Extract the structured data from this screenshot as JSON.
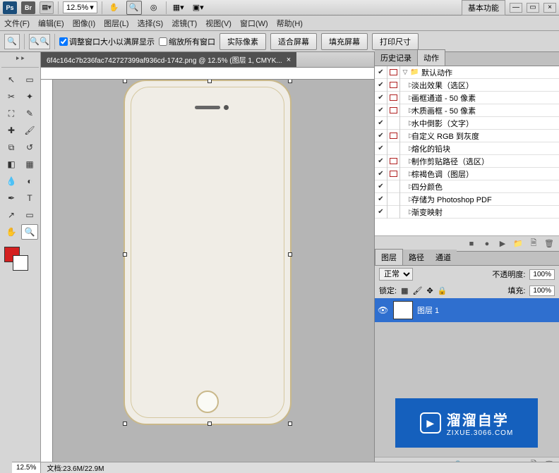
{
  "titlebar": {
    "ps_label": "Ps",
    "br_label": "Br",
    "zoom": "12.5%",
    "workspace": "基本功能"
  },
  "menus": [
    "文件(F)",
    "编辑(E)",
    "图像(I)",
    "图层(L)",
    "选择(S)",
    "滤镜(T)",
    "视图(V)",
    "窗口(W)",
    "帮助(H)"
  ],
  "options": {
    "fit_window_label": "调整窗口大小以满屏显示",
    "scale_all_label": "缩放所有窗口",
    "btn1": "实际像素",
    "btn2": "适合屏幕",
    "btn3": "填充屏幕",
    "btn4": "打印尺寸"
  },
  "doc_tab": {
    "title": "6f4c164c7b236fac742727399af936cd-1742.png @ 12.5% (图层 1, CMYK...",
    "close": "×"
  },
  "status": {
    "zoom": "12.5%",
    "doc_size": "文档:23.6M/22.9M"
  },
  "history_tab": "历史记录",
  "actions_tab": "动作",
  "action_set": "默认动作",
  "actions": [
    "淡出效果（选区）",
    "画框通道 - 50 像素",
    "木质画框 - 50 像素",
    "水中倒影（文字）",
    "自定义 RGB 到灰度",
    "熔化的铅块",
    "制作剪贴路径（选区）",
    "棕褐色调（图层）",
    "四分颜色",
    "存储为 Photoshop PDF",
    "渐变映射"
  ],
  "action_dialogs": [
    true,
    true,
    true,
    false,
    true,
    false,
    true,
    true,
    false,
    false,
    false
  ],
  "layers": {
    "tab1": "图层",
    "tab2": "路径",
    "tab3": "通道",
    "blend": "正常",
    "opacity_label": "不透明度:",
    "opacity_val": "100%",
    "lock_label": "锁定:",
    "fill_label": "填充:",
    "fill_val": "100%",
    "layer1": "图层 1"
  },
  "watermark": {
    "big": "溜溜自学",
    "small": "ZIXUE.3066.COM"
  }
}
